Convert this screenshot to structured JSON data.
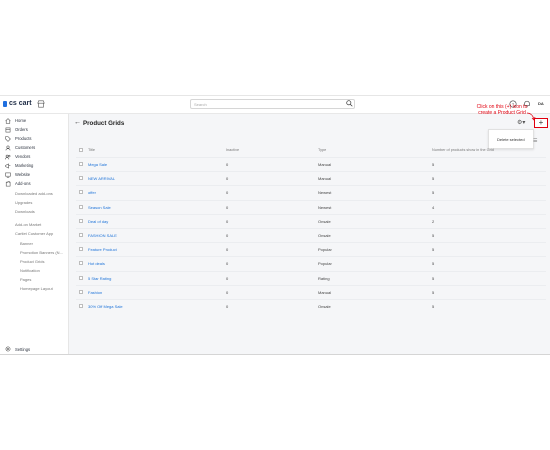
{
  "topbar": {
    "logo_text": "cs cart",
    "search_placeholder": "Search",
    "avatar_initials": "DA"
  },
  "sidebar": {
    "items": [
      {
        "label": "Home",
        "icon": "home-icon"
      },
      {
        "label": "Orders",
        "icon": "orders-icon"
      },
      {
        "label": "Products",
        "icon": "tag-icon"
      },
      {
        "label": "Customers",
        "icon": "user-icon"
      },
      {
        "label": "Vendors",
        "icon": "users-icon"
      },
      {
        "label": "Marketing",
        "icon": "megaphone-icon"
      },
      {
        "label": "Website",
        "icon": "monitor-icon"
      },
      {
        "label": "Add-ons",
        "icon": "puzzle-icon"
      }
    ],
    "addons_sub": [
      "Downloaded add-ons",
      "Upgrades",
      "Downloads"
    ],
    "addons_sub2": [
      "Add-on Market",
      "Cartlet Customer App"
    ],
    "app_sub": [
      "Banner",
      "Promotion Banners (N...",
      "Product Grids",
      "Notification",
      "Pages",
      "Homepage Layout"
    ],
    "settings_label": "Settings"
  },
  "page": {
    "title": "Product Grids",
    "dropdown_item": "Delete selected",
    "annotation": "Click on this (+) icon to create a Product Grid"
  },
  "table": {
    "headers": [
      "Title",
      "Inactive",
      "Type",
      "Number of products show in the Grid"
    ],
    "rows": [
      {
        "title": "Mega Sale",
        "inactive": "0",
        "type": "Manual",
        "count": "5"
      },
      {
        "title": "NEW ARRIVAL",
        "inactive": "0",
        "type": "Manual",
        "count": "5"
      },
      {
        "title": "offer",
        "inactive": "0",
        "type": "Newest",
        "count": "5"
      },
      {
        "title": "Season Sale",
        "inactive": "0",
        "type": "Newest",
        "count": "4"
      },
      {
        "title": "Deal of day",
        "inactive": "0",
        "type": "Onsale",
        "count": "2"
      },
      {
        "title": "FASHION SALE",
        "inactive": "0",
        "type": "Onsale",
        "count": "5"
      },
      {
        "title": "Feature Product",
        "inactive": "0",
        "type": "Popular",
        "count": "5"
      },
      {
        "title": "Hot deals",
        "inactive": "0",
        "type": "Popular",
        "count": "5"
      },
      {
        "title": "5 Star Rating",
        "inactive": "0",
        "type": "Rating",
        "count": "5"
      },
      {
        "title": "Fashion",
        "inactive": "0",
        "type": "Manual",
        "count": "5"
      },
      {
        "title": "30% Off Mega Sale",
        "inactive": "0",
        "type": "Onsale",
        "count": "5"
      }
    ]
  },
  "colors": {
    "accent": "#1f6fe0",
    "link": "#1c72d8",
    "annotation": "#e1000f"
  }
}
